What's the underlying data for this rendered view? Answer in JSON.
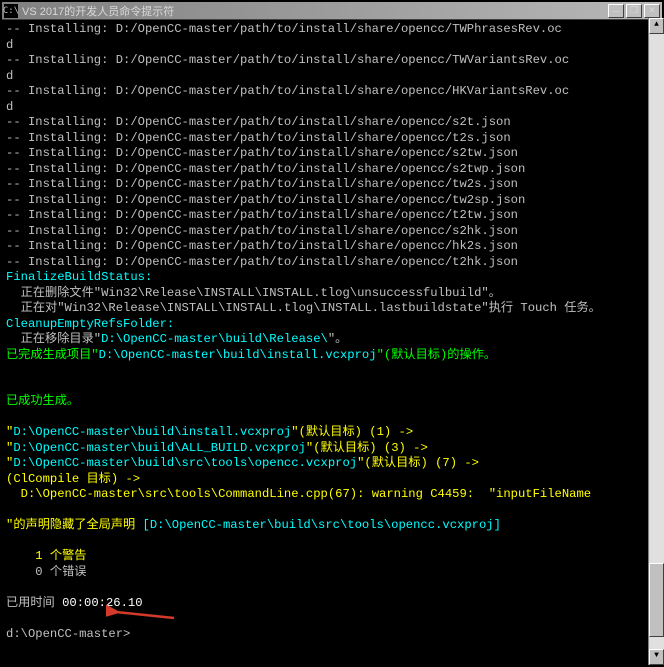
{
  "window": {
    "title": "VS 2017的开发人员命令提示符",
    "icon_label": "C:\\"
  },
  "install": {
    "prefix": "-- Installing: ",
    "lines": [
      "D:/OpenCC-master/path/to/install/share/opencc/TWPhrasesRev.ocd",
      "D:/OpenCC-master/path/to/install/share/opencc/TWVariantsRev.ocd",
      "D:/OpenCC-master/path/to/install/share/opencc/HKVariantsRev.ocd",
      "D:/OpenCC-master/path/to/install/share/opencc/s2t.json",
      "D:/OpenCC-master/path/to/install/share/opencc/t2s.json",
      "D:/OpenCC-master/path/to/install/share/opencc/s2tw.json",
      "D:/OpenCC-master/path/to/install/share/opencc/s2twp.json",
      "D:/OpenCC-master/path/to/install/share/opencc/tw2s.json",
      "D:/OpenCC-master/path/to/install/share/opencc/tw2sp.json",
      "D:/OpenCC-master/path/to/install/share/opencc/t2tw.json",
      "D:/OpenCC-master/path/to/install/share/opencc/s2hk.json",
      "D:/OpenCC-master/path/to/install/share/opencc/hk2s.json",
      "D:/OpenCC-master/path/to/install/share/opencc/t2hk.json"
    ]
  },
  "finalize": {
    "header": "FinalizeBuildStatus:",
    "line1_a": "  正在删除文件\"",
    "line1_b": "Win32\\Release\\INSTALL\\INSTALL.tlog\\unsuccessfulbuild",
    "line1_c": "\"。",
    "line2_a": "  正在对\"",
    "line2_b": "Win32\\Release\\INSTALL\\INSTALL.tlog\\INSTALL.lastbuildstate",
    "line2_c": "\"执行 Touch 任务。"
  },
  "cleanup": {
    "header": "CleanupEmptyRefsFolder:",
    "line1_a": "  正在移除目录\"",
    "line1_b": "D:\\OpenCC-master\\build\\Release\\",
    "line1_c": "\"。"
  },
  "done_project": {
    "a": "已完成生成项目\"",
    "b": "D:\\OpenCC-master\\build\\install.vcxproj",
    "c": "\"(默认目标)的操作。"
  },
  "success": "已成功生成。",
  "proj_lines": [
    {
      "a": "\"",
      "b": "D:\\OpenCC-master\\build\\install.vcxproj",
      "c": "\"(默认目标) (1) ->"
    },
    {
      "a": "\"",
      "b": "D:\\OpenCC-master\\build\\ALL_BUILD.vcxproj",
      "c": "\"(默认目标) (3) ->"
    },
    {
      "a": "\"",
      "b": "D:\\OpenCC-master\\build\\src\\tools\\opencc.vcxproj",
      "c": "\"(默认目标) (7) ->"
    }
  ],
  "clcompile": "(ClCompile 目标) ->",
  "warning": {
    "a": "  D:\\OpenCC-master\\src\\tools\\CommandLine.cpp(67): warning C4459:  \"",
    "b": "inputFileName",
    "c_prefix": "\"的声明隐藏了全局声明 ",
    "c_proj": "[D:\\OpenCC-master\\build\\src\\tools\\opencc.vcxproj]"
  },
  "summary": {
    "warn_count": "1",
    "warn_label": " 个警告",
    "err_count": "0",
    "err_label": " 个错误"
  },
  "elapsed": {
    "label": "已用时间 ",
    "value": "00:00:26.10"
  },
  "prompt": "d:\\OpenCC-master>"
}
